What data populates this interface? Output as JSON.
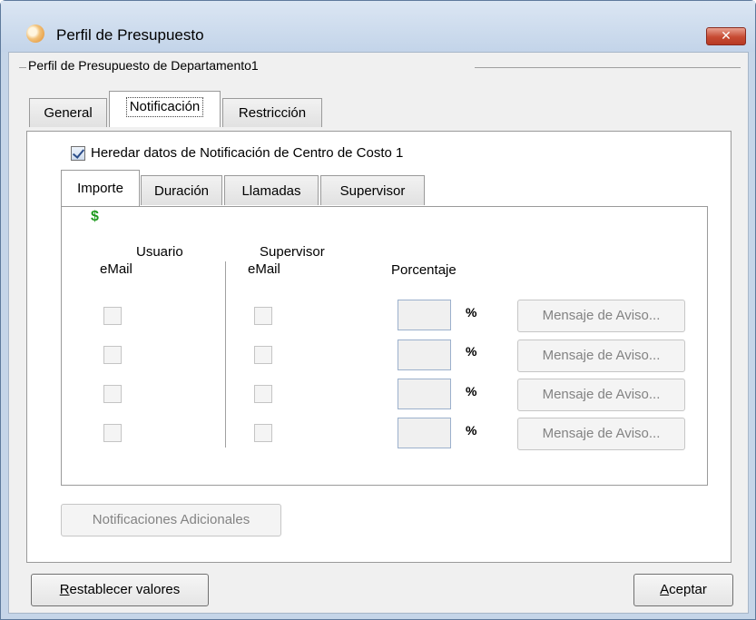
{
  "window": {
    "title": "Perfil de Presupuesto",
    "close_glyph": "✕"
  },
  "group": {
    "title": "Perfil de Presupuesto de Departamento1"
  },
  "tabs": [
    {
      "label": "General"
    },
    {
      "label": "Notificación",
      "active": true
    },
    {
      "label": "Restricción"
    }
  ],
  "notification": {
    "inherit_checked": true,
    "inherit_label": "Heredar datos de Notificación de Centro de Costo 1",
    "inner_tabs": [
      {
        "label": "Importe",
        "active": true
      },
      {
        "label": "Duración"
      },
      {
        "label": "Llamadas"
      },
      {
        "label": "Supervisor"
      }
    ],
    "currency_symbol": "$",
    "headers": {
      "usuario": "Usuario",
      "usuario_email": "eMail",
      "supervisor": "Supervisor",
      "supervisor_email": "eMail",
      "porcentaje": "Porcentaje"
    },
    "rows": [
      {
        "percent_value": "",
        "percent_sign": "%",
        "message_button": "Mensaje de Aviso..."
      },
      {
        "percent_value": "",
        "percent_sign": "%",
        "message_button": "Mensaje de Aviso..."
      },
      {
        "percent_value": "",
        "percent_sign": "%",
        "message_button": "Mensaje de Aviso..."
      },
      {
        "percent_value": "",
        "percent_sign": "%",
        "message_button": "Mensaje de Aviso..."
      }
    ],
    "additional_button": "Notificaciones Adicionales"
  },
  "footer": {
    "reset_first": "R",
    "reset_rest": "establecer valores",
    "accept_first": "A",
    "accept_rest": "ceptar"
  },
  "colors": {
    "currency_green": "#1e9a1e",
    "close_red": "#c64a32",
    "title_gradient_top": "#dbe6f3"
  },
  "icons": {
    "app": "presupuesto-app-icon",
    "close": "close-icon",
    "check": "checkmark-icon"
  }
}
